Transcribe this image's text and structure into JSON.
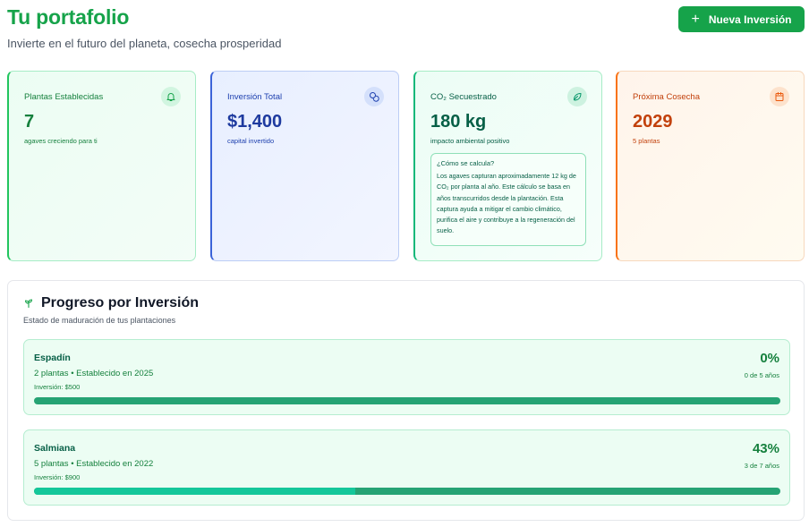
{
  "header": {
    "title": "Tu portafolio",
    "subtitle": "Invierte en el futuro del planeta, cosecha prosperidad",
    "new_button_label": "Nueva Inversión"
  },
  "cards": [
    {
      "label": "Plantas Establecidas",
      "value": "7",
      "sub": "agaves creciendo para ti",
      "icon": "sprout-bell-icon",
      "accent": "#16a34a"
    },
    {
      "label": "Inversión Total",
      "value": "$1,400",
      "sub": "capital invertido",
      "icon": "coins-icon",
      "accent": "#1e40af"
    },
    {
      "label": "CO₂ Secuestrado",
      "value": "180 kg",
      "sub": "impacto ambiental positivo",
      "icon": "leaf-icon",
      "accent": "#065f46",
      "info_title": "¿Cómo se calcula?",
      "info_body": "Los agaves capturan aproximadamente 12 kg de CO₂ por planta al año. Este cálculo se basa en años transcurridos desde la plantación. Esta captura ayuda a mitigar el cambio climático, purifica el aire y contribuye a la regeneración del suelo."
    },
    {
      "label": "Próxima Cosecha",
      "value": "2029",
      "sub": "5 plantas",
      "icon": "calendar-icon",
      "accent": "#c2410c"
    }
  ],
  "progress": {
    "title": "Progreso por Inversión",
    "subtitle": "Estado de maduración de tus plantaciones",
    "items": [
      {
        "name": "Espadín",
        "meta": "2 plantas • Establecido en 2025",
        "amount": "Inversión: $500",
        "percent_label": "0%",
        "years": "0 de 5 años",
        "progress": 0.0
      },
      {
        "name": "Salmiana",
        "meta": "5 plantas • Establecido en 2022",
        "amount": "Inversión: $900",
        "percent_label": "43%",
        "years": "3 de 7 años",
        "progress": 0.43
      }
    ]
  }
}
